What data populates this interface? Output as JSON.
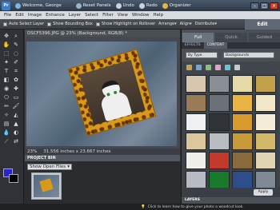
{
  "titlebar": {
    "welcome": "Welcome, George",
    "reset_panels": "Reset Panels",
    "undo": "Undo",
    "redo": "Redo",
    "organizer": "Organizer",
    "minimize": "–",
    "maximize": "□",
    "close": "×"
  },
  "menu": [
    "File",
    "Edit",
    "Image",
    "Enhance",
    "Layer",
    "Select",
    "Filter",
    "View",
    "Window",
    "Help"
  ],
  "options": {
    "auto_select": "Auto Select Layer",
    "bounding_box": "Show Bounding Box",
    "highlight": "Show Highlight on Rollover",
    "arrange": "Arrange",
    "align": "Align",
    "distribute": "Distribute",
    "edit_label": "Edit"
  },
  "document": {
    "tab_title": "DSCF5396.JPG @ 23% (Background, RGB/8) *",
    "zoom": "23%",
    "dimensions": "31.556 inches x 23.667 inches"
  },
  "project_bin": {
    "title": "PROJECT BIN",
    "selector": "Show Open Files"
  },
  "panel": {
    "tabs": [
      "Full",
      "Quick",
      "Guided"
    ],
    "subtabs": [
      "EFFECTS",
      "CONTENT"
    ],
    "filter_type": "By Type",
    "filter_category": "Backgrounds",
    "apply": "Apply",
    "layers": "LAYERS"
  },
  "bottom": {
    "tip": "Click to learn how to give your photo a woodcut look."
  },
  "colors": {
    "foreground": "#2d1fd8",
    "background": "#000000",
    "accent": "#3f7ec0"
  }
}
